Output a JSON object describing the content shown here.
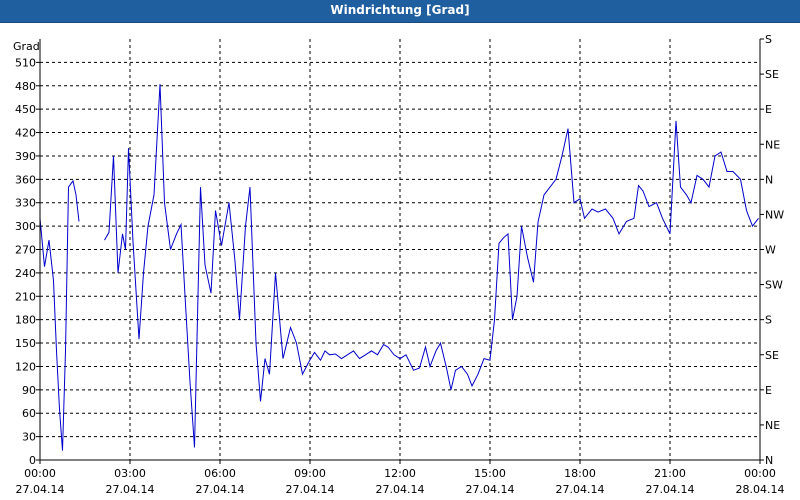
{
  "window": {
    "title": "Windrichtung [Grad]"
  },
  "chart_data": {
    "type": "line",
    "title": "Windrichtung [Grad]",
    "ylabel": "Grad",
    "ylim": [
      0,
      540
    ],
    "grid": true,
    "y_ticks": [
      0,
      30,
      60,
      90,
      120,
      150,
      180,
      210,
      240,
      270,
      300,
      330,
      360,
      390,
      420,
      450,
      480,
      510
    ],
    "right_axis_labels": [
      "N",
      "NE",
      "E",
      "SE",
      "S",
      "SW",
      "W",
      "NW",
      "N",
      "NE",
      "E",
      "SE",
      "S"
    ],
    "x_ticks": [
      {
        "time": "00:00",
        "date": "27.04.14"
      },
      {
        "time": "03:00",
        "date": "27.04.14"
      },
      {
        "time": "06:00",
        "date": "27.04.14"
      },
      {
        "time": "09:00",
        "date": "27.04.14"
      },
      {
        "time": "12:00",
        "date": "27.04.14"
      },
      {
        "time": "15:00",
        "date": "27.04.14"
      },
      {
        "time": "18:00",
        "date": "27.04.14"
      },
      {
        "time": "21:00",
        "date": "27.04.14"
      },
      {
        "time": "00:00",
        "date": "28.04.14"
      }
    ],
    "xlim_hours": [
      0,
      24
    ],
    "line_color": "#0000cc",
    "series": [
      {
        "segments": [
          [
            [
              0.0,
              310
            ],
            [
              0.15,
              248
            ],
            [
              0.3,
              282
            ],
            [
              0.45,
              230
            ],
            [
              0.55,
              140
            ],
            [
              0.65,
              65
            ],
            [
              0.75,
              12
            ],
            [
              0.85,
              140
            ],
            [
              0.95,
              350
            ],
            [
              1.1,
              358
            ],
            [
              1.2,
              340
            ],
            [
              1.3,
              306
            ]
          ],
          [
            [
              2.15,
              282
            ],
            [
              2.3,
              292
            ],
            [
              2.45,
              390
            ],
            [
              2.6,
              240
            ],
            [
              2.75,
              290
            ],
            [
              2.85,
              270
            ],
            [
              2.95,
              400
            ],
            [
              3.1,
              280
            ],
            [
              3.3,
              155
            ],
            [
              3.45,
              240
            ],
            [
              3.6,
              300
            ],
            [
              3.8,
              340
            ],
            [
              4.0,
              482
            ],
            [
              4.15,
              330
            ],
            [
              4.35,
              270
            ],
            [
              4.55,
              290
            ],
            [
              4.7,
              302
            ],
            [
              4.85,
              200
            ],
            [
              5.0,
              100
            ],
            [
              5.15,
              16
            ],
            [
              5.35,
              350
            ],
            [
              5.5,
              250
            ],
            [
              5.7,
              214
            ],
            [
              5.85,
              320
            ],
            [
              6.05,
              275
            ],
            [
              6.3,
              330
            ],
            [
              6.5,
              255
            ],
            [
              6.65,
              180
            ],
            [
              6.85,
              300
            ],
            [
              7.0,
              350
            ],
            [
              7.2,
              150
            ],
            [
              7.35,
              75
            ],
            [
              7.5,
              130
            ],
            [
              7.65,
              110
            ],
            [
              7.85,
              240
            ],
            [
              8.1,
              130
            ],
            [
              8.35,
              170
            ],
            [
              8.55,
              150
            ],
            [
              8.75,
              110
            ],
            [
              8.95,
              125
            ],
            [
              9.15,
              138
            ],
            [
              9.35,
              128
            ],
            [
              9.5,
              140
            ],
            [
              9.65,
              135
            ],
            [
              9.85,
              136
            ],
            [
              10.05,
              130
            ],
            [
              10.25,
              135
            ],
            [
              10.45,
              140
            ],
            [
              10.65,
              130
            ],
            [
              10.85,
              135
            ],
            [
              11.05,
              140
            ],
            [
              11.25,
              135
            ],
            [
              11.45,
              148
            ],
            [
              11.6,
              145
            ],
            [
              11.8,
              135
            ],
            [
              12.0,
              130
            ],
            [
              12.2,
              135
            ],
            [
              12.45,
              115
            ],
            [
              12.65,
              118
            ],
            [
              12.85,
              145
            ],
            [
              13.0,
              120
            ],
            [
              13.2,
              140
            ],
            [
              13.35,
              150
            ],
            [
              13.55,
              118
            ],
            [
              13.7,
              90
            ],
            [
              13.85,
              115
            ],
            [
              14.05,
              120
            ],
            [
              14.25,
              110
            ],
            [
              14.4,
              95
            ],
            [
              14.6,
              110
            ],
            [
              14.8,
              130
            ],
            [
              15.0,
              128
            ],
            [
              15.15,
              180
            ],
            [
              15.3,
              278
            ],
            [
              15.45,
              285
            ],
            [
              15.6,
              290
            ],
            [
              15.75,
              180
            ],
            [
              15.9,
              210
            ],
            [
              16.05,
              300
            ],
            [
              16.25,
              260
            ],
            [
              16.45,
              228
            ],
            [
              16.6,
              305
            ],
            [
              16.8,
              340
            ],
            [
              17.0,
              350
            ],
            [
              17.2,
              360
            ],
            [
              17.4,
              390
            ],
            [
              17.6,
              425
            ],
            [
              17.8,
              330
            ],
            [
              18.0,
              335
            ],
            [
              18.15,
              310
            ],
            [
              18.4,
              322
            ],
            [
              18.6,
              318
            ],
            [
              18.85,
              322
            ],
            [
              19.1,
              310
            ],
            [
              19.3,
              290
            ],
            [
              19.55,
              306
            ],
            [
              19.8,
              310
            ],
            [
              19.95,
              352
            ],
            [
              20.1,
              345
            ],
            [
              20.3,
              325
            ],
            [
              20.55,
              330
            ],
            [
              20.75,
              310
            ],
            [
              21.0,
              290
            ],
            [
              21.2,
              435
            ],
            [
              21.35,
              350
            ],
            [
              21.55,
              340
            ],
            [
              21.7,
              330
            ],
            [
              21.9,
              365
            ],
            [
              22.1,
              360
            ],
            [
              22.3,
              350
            ],
            [
              22.5,
              390
            ],
            [
              22.7,
              395
            ],
            [
              22.9,
              370
            ],
            [
              23.1,
              370
            ],
            [
              23.35,
              360
            ],
            [
              23.55,
              320
            ],
            [
              23.75,
              300
            ],
            [
              23.95,
              310
            ]
          ]
        ]
      }
    ]
  }
}
